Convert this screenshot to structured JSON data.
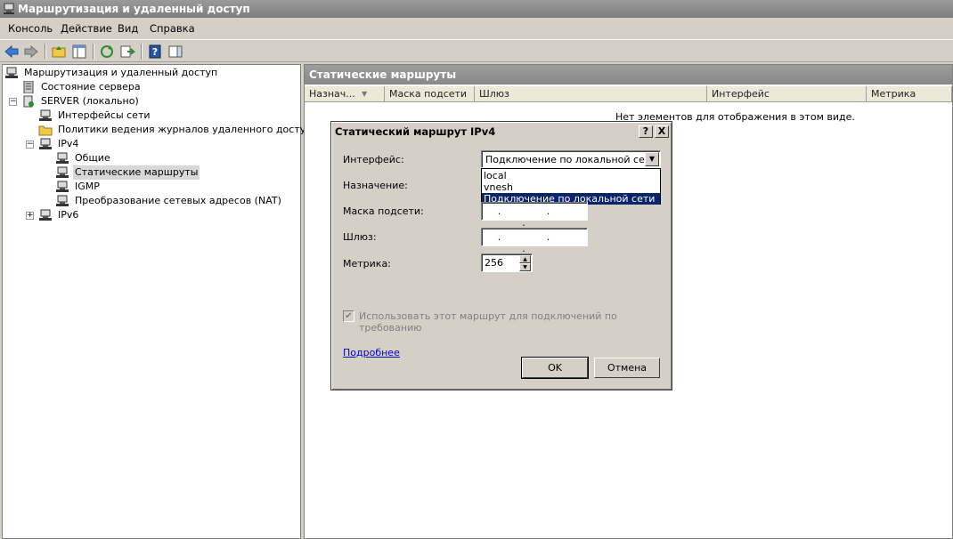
{
  "window": {
    "title": "Маршрутизация и удаленный доступ"
  },
  "menu": [
    "Консоль",
    "Действие",
    "Вид",
    "Справка"
  ],
  "tree": {
    "items": [
      {
        "label": "Маршрутизация и удаленный доступ"
      },
      {
        "label": "Состояние сервера"
      },
      {
        "label": "SERVER (локально)"
      },
      {
        "label": "Интерфейсы сети"
      },
      {
        "label": "Политики ведения журналов удаленного доступа"
      },
      {
        "label": "IPv4"
      },
      {
        "label": "Общие"
      },
      {
        "label": "Статические маршруты"
      },
      {
        "label": "IGMP"
      },
      {
        "label": "Преобразование сетевых адресов (NAT)"
      },
      {
        "label": "IPv6"
      }
    ]
  },
  "right_pane": {
    "header": "Статические маршруты",
    "columns": [
      "Назнач...",
      "Маска подсети",
      "Шлюз",
      "Интерфейс",
      "Метрика"
    ],
    "empty_message": "Нет элементов для отображения в этом виде."
  },
  "dialog": {
    "title": "Статический маршрут IPv4",
    "help_btn": "?",
    "close_btn": "X",
    "interface_label": "Интерфейс:",
    "interface_value": "Подключение по локальной сети",
    "interface_options": [
      "local",
      "vnesh",
      "Подключение по локальной сети"
    ],
    "destination_label": "Назначение:",
    "mask_label": "Маска подсети:",
    "gateway_label": "Шлюз:",
    "ip_dots": ". . .",
    "metric_label": "Метрика:",
    "metric_value": "256",
    "checkbox_label": "Использовать этот маршрут для подключений по требованию",
    "checkbox_checked": true,
    "more_link": "Подробнее",
    "ok": "OK",
    "cancel": "Отмена"
  }
}
